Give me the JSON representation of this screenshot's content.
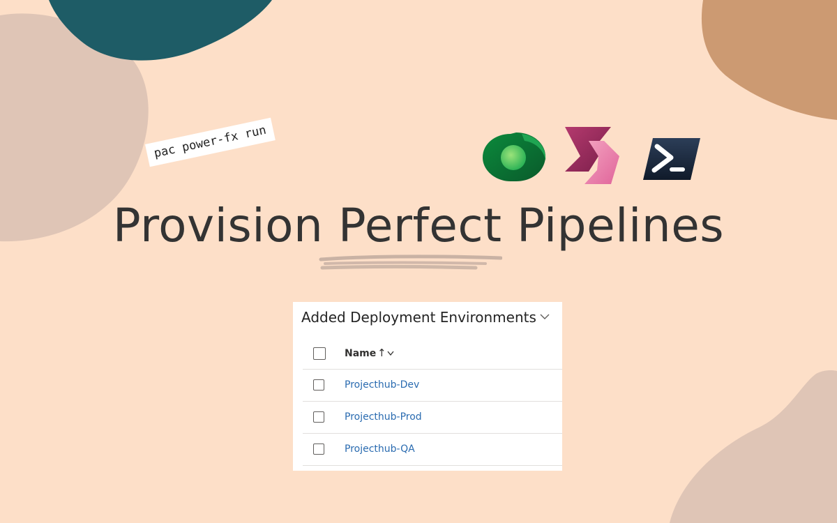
{
  "command_tag": "pac power-fx run",
  "headline": "Provision Perfect Pipelines",
  "logos": [
    "dataverse-logo",
    "power-automate-logo",
    "powershell-logo"
  ],
  "colors": {
    "background": "#fddfc8",
    "blob_teal": "#1e5c66",
    "blob_taupe": "#dfc5b6",
    "blob_tan": "#cc9a72",
    "link": "#2a6bb0"
  },
  "panel": {
    "title": "Added Deployment Environments",
    "column_header": "Name",
    "sort_indicator": "↑",
    "rows": [
      {
        "name": "Projecthub-Dev"
      },
      {
        "name": "Projecthub-Prod"
      },
      {
        "name": "Projecthub-QA"
      }
    ]
  }
}
